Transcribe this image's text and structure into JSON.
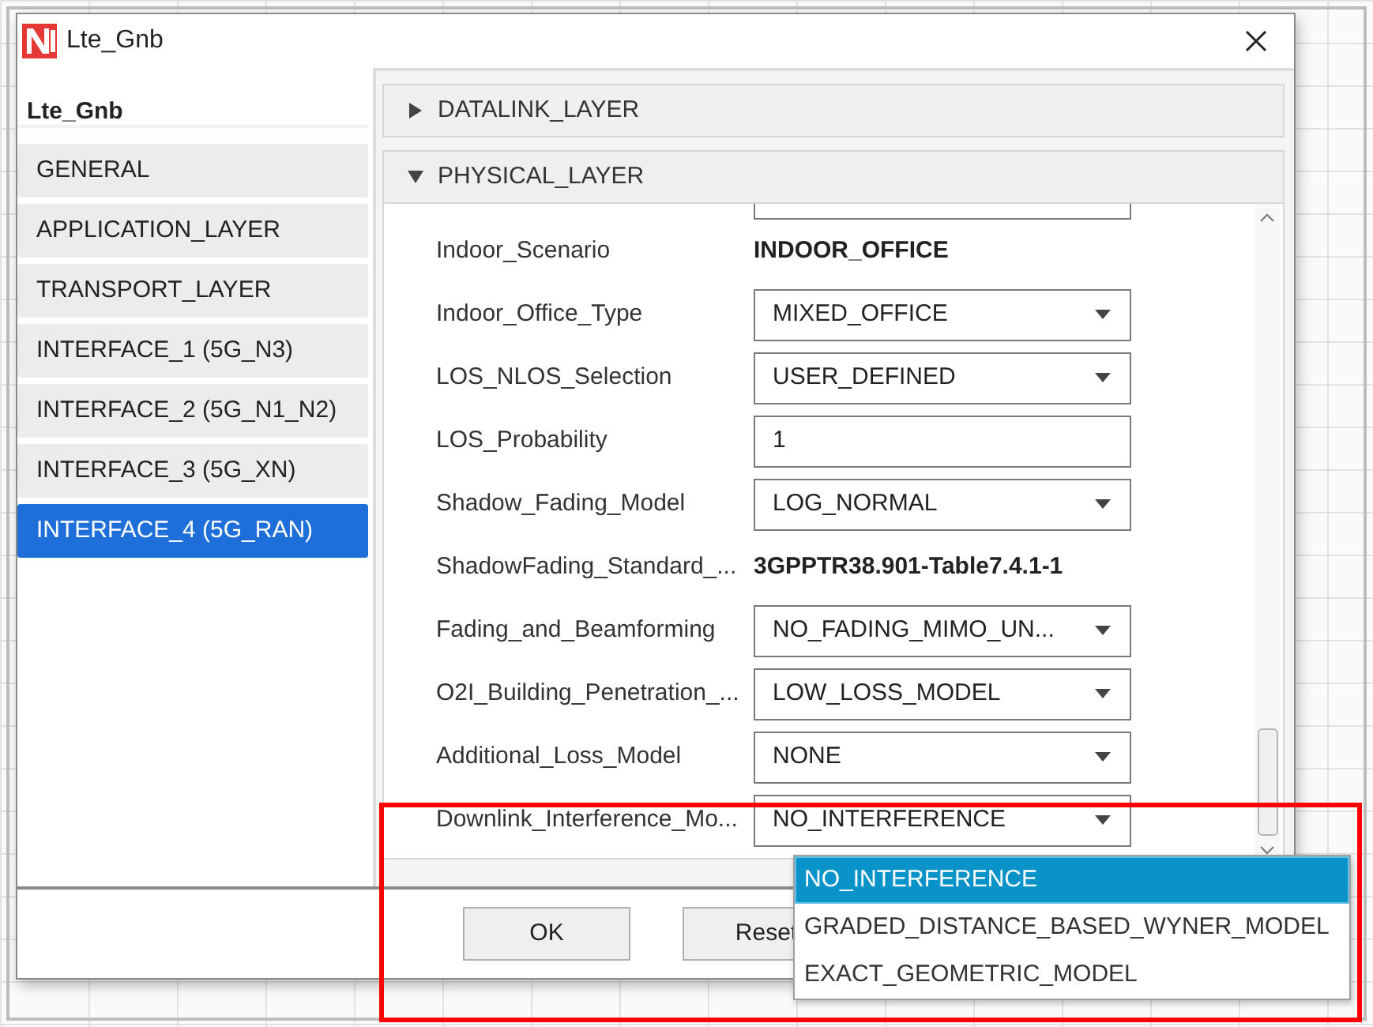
{
  "window": {
    "title": "Lte_Gnb"
  },
  "sidebar": {
    "title": "Lte_Gnb",
    "items": [
      {
        "label": "GENERAL",
        "selected": false
      },
      {
        "label": "APPLICATION_LAYER",
        "selected": false
      },
      {
        "label": "TRANSPORT_LAYER",
        "selected": false
      },
      {
        "label": "INTERFACE_1 (5G_N3)",
        "selected": false
      },
      {
        "label": "INTERFACE_2 (5G_N1_N2)",
        "selected": false
      },
      {
        "label": "INTERFACE_3 (5G_XN)",
        "selected": false
      },
      {
        "label": "INTERFACE_4 (5G_RAN)",
        "selected": true
      }
    ]
  },
  "sections": [
    {
      "title": "DATALINK_LAYER",
      "expanded": false
    },
    {
      "title": "PHYSICAL_LAYER",
      "expanded": true
    }
  ],
  "fields": [
    {
      "label": "Indoor_Scenario",
      "kind": "static",
      "value": "INDOOR_OFFICE"
    },
    {
      "label": "Indoor_Office_Type",
      "kind": "select",
      "value": "MIXED_OFFICE"
    },
    {
      "label": "LOS_NLOS_Selection",
      "kind": "select",
      "value": "USER_DEFINED"
    },
    {
      "label": "LOS_Probability",
      "kind": "text",
      "value": "1"
    },
    {
      "label": "Shadow_Fading_Model",
      "kind": "select",
      "value": "LOG_NORMAL"
    },
    {
      "label": "ShadowFading_Standard_...",
      "kind": "static",
      "value": "3GPPTR38.901-Table7.4.1-1"
    },
    {
      "label": "Fading_and_Beamforming",
      "kind": "select",
      "value": "NO_FADING_MIMO_UN..."
    },
    {
      "label": "O2I_Building_Penetration_...",
      "kind": "select",
      "value": "LOW_LOSS_MODEL"
    },
    {
      "label": "Additional_Loss_Model",
      "kind": "select",
      "value": "NONE"
    },
    {
      "label": "Downlink_Interference_Mo...",
      "kind": "select",
      "value": "NO_INTERFERENCE"
    }
  ],
  "dropdown": {
    "options": [
      {
        "label": "NO_INTERFERENCE",
        "selected": true
      },
      {
        "label": "GRADED_DISTANCE_BASED_WYNER_MODEL",
        "selected": false
      },
      {
        "label": "EXACT_GEOMETRIC_MODEL",
        "selected": false
      }
    ]
  },
  "buttons": [
    "OK",
    "Reset"
  ]
}
